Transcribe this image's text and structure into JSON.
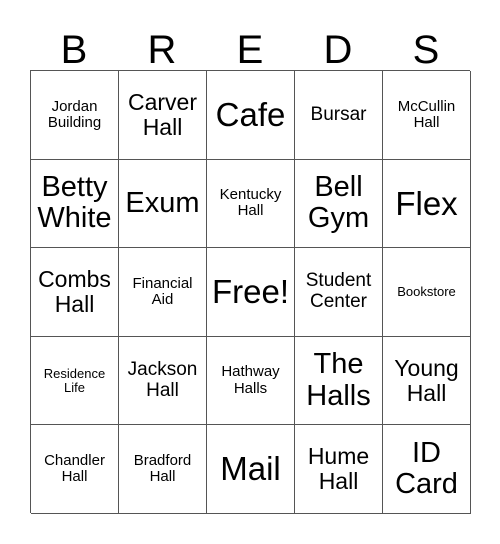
{
  "card": {
    "header_letters": [
      "B",
      "R",
      "E",
      "D",
      "S"
    ],
    "border_color": "#555555",
    "background_color": "#ffffff",
    "text_color": "#000000",
    "rows": [
      [
        {
          "label": "Jordan Building",
          "size": "sz-s",
          "free": false
        },
        {
          "label": "Carver Hall",
          "size": "sz-l",
          "free": false
        },
        {
          "label": "Cafe",
          "size": "sz-xxl",
          "free": false
        },
        {
          "label": "Bursar",
          "size": "sz-m",
          "free": false
        },
        {
          "label": "McCullin Hall",
          "size": "sz-s",
          "free": false
        }
      ],
      [
        {
          "label": "Betty White",
          "size": "sz-xl",
          "free": false
        },
        {
          "label": "Exum",
          "size": "sz-xl",
          "free": false
        },
        {
          "label": "Kentucky Hall",
          "size": "sz-s",
          "free": false
        },
        {
          "label": "Bell Gym",
          "size": "sz-xl",
          "free": false
        },
        {
          "label": "Flex",
          "size": "sz-xxl",
          "free": false
        }
      ],
      [
        {
          "label": "Combs Hall",
          "size": "sz-l",
          "free": false
        },
        {
          "label": "Financial Aid",
          "size": "sz-s",
          "free": false
        },
        {
          "label": "Free!",
          "size": "sz-xxl",
          "free": true
        },
        {
          "label": "Student Center",
          "size": "sz-m",
          "free": false
        },
        {
          "label": "Bookstore",
          "size": "sz-xs",
          "free": false
        }
      ],
      [
        {
          "label": "Residence Life",
          "size": "sz-xs",
          "free": false
        },
        {
          "label": "Jackson Hall",
          "size": "sz-m",
          "free": false
        },
        {
          "label": "Hathway Halls",
          "size": "sz-s",
          "free": false
        },
        {
          "label": "The Halls",
          "size": "sz-xl",
          "free": false
        },
        {
          "label": "Young Hall",
          "size": "sz-l",
          "free": false
        }
      ],
      [
        {
          "label": "Chandler Hall",
          "size": "sz-s",
          "free": false
        },
        {
          "label": "Bradford Hall",
          "size": "sz-s",
          "free": false
        },
        {
          "label": "Mail",
          "size": "sz-xxl",
          "free": false
        },
        {
          "label": "Hume Hall",
          "size": "sz-l",
          "free": false
        },
        {
          "label": "ID Card",
          "size": "sz-xl",
          "free": false
        }
      ]
    ]
  }
}
